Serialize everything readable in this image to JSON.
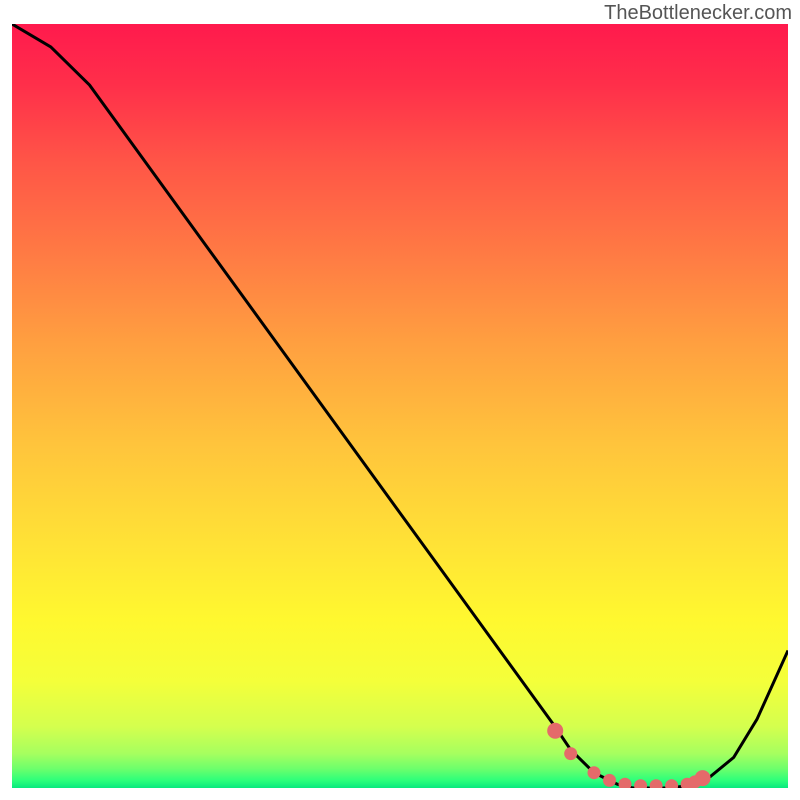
{
  "attribution": "TheBottlenecker.com",
  "chart_data": {
    "type": "line",
    "title": "",
    "xlabel": "",
    "ylabel": "",
    "xlim": [
      0,
      100
    ],
    "ylim": [
      0,
      100
    ],
    "series": [
      {
        "name": "curve",
        "x": [
          0,
          5,
          10,
          15,
          20,
          25,
          30,
          35,
          40,
          45,
          50,
          55,
          60,
          65,
          70,
          72,
          75,
          78,
          80,
          82,
          85,
          88,
          90,
          93,
          96,
          100
        ],
        "y": [
          100,
          97,
          92,
          85,
          78,
          71,
          64,
          57,
          50,
          43,
          36,
          29,
          22,
          15,
          8,
          5,
          2,
          0.5,
          0,
          0,
          0,
          0.5,
          1.5,
          4,
          9,
          18
        ]
      }
    ],
    "markers": {
      "x": [
        70,
        72,
        75,
        77,
        79,
        81,
        83,
        85,
        87,
        88,
        89
      ],
      "y": [
        7.5,
        4.5,
        2,
        1,
        0.5,
        0.3,
        0.3,
        0.3,
        0.5,
        0.8,
        1.3
      ]
    },
    "gradient_stops": [
      {
        "offset": 0.0,
        "color": "#ff1a4d"
      },
      {
        "offset": 0.08,
        "color": "#ff2f4a"
      },
      {
        "offset": 0.18,
        "color": "#ff5547"
      },
      {
        "offset": 0.3,
        "color": "#ff7a44"
      },
      {
        "offset": 0.42,
        "color": "#ffa040"
      },
      {
        "offset": 0.55,
        "color": "#ffc43c"
      },
      {
        "offset": 0.68,
        "color": "#ffe236"
      },
      {
        "offset": 0.78,
        "color": "#fff82f"
      },
      {
        "offset": 0.86,
        "color": "#f4ff3a"
      },
      {
        "offset": 0.92,
        "color": "#d4ff4e"
      },
      {
        "offset": 0.955,
        "color": "#a6ff5f"
      },
      {
        "offset": 0.975,
        "color": "#6cff6c"
      },
      {
        "offset": 0.99,
        "color": "#2dff7a"
      },
      {
        "offset": 1.0,
        "color": "#08e87e"
      }
    ],
    "marker_color": "#e46a6a",
    "line_color": "#000000"
  }
}
